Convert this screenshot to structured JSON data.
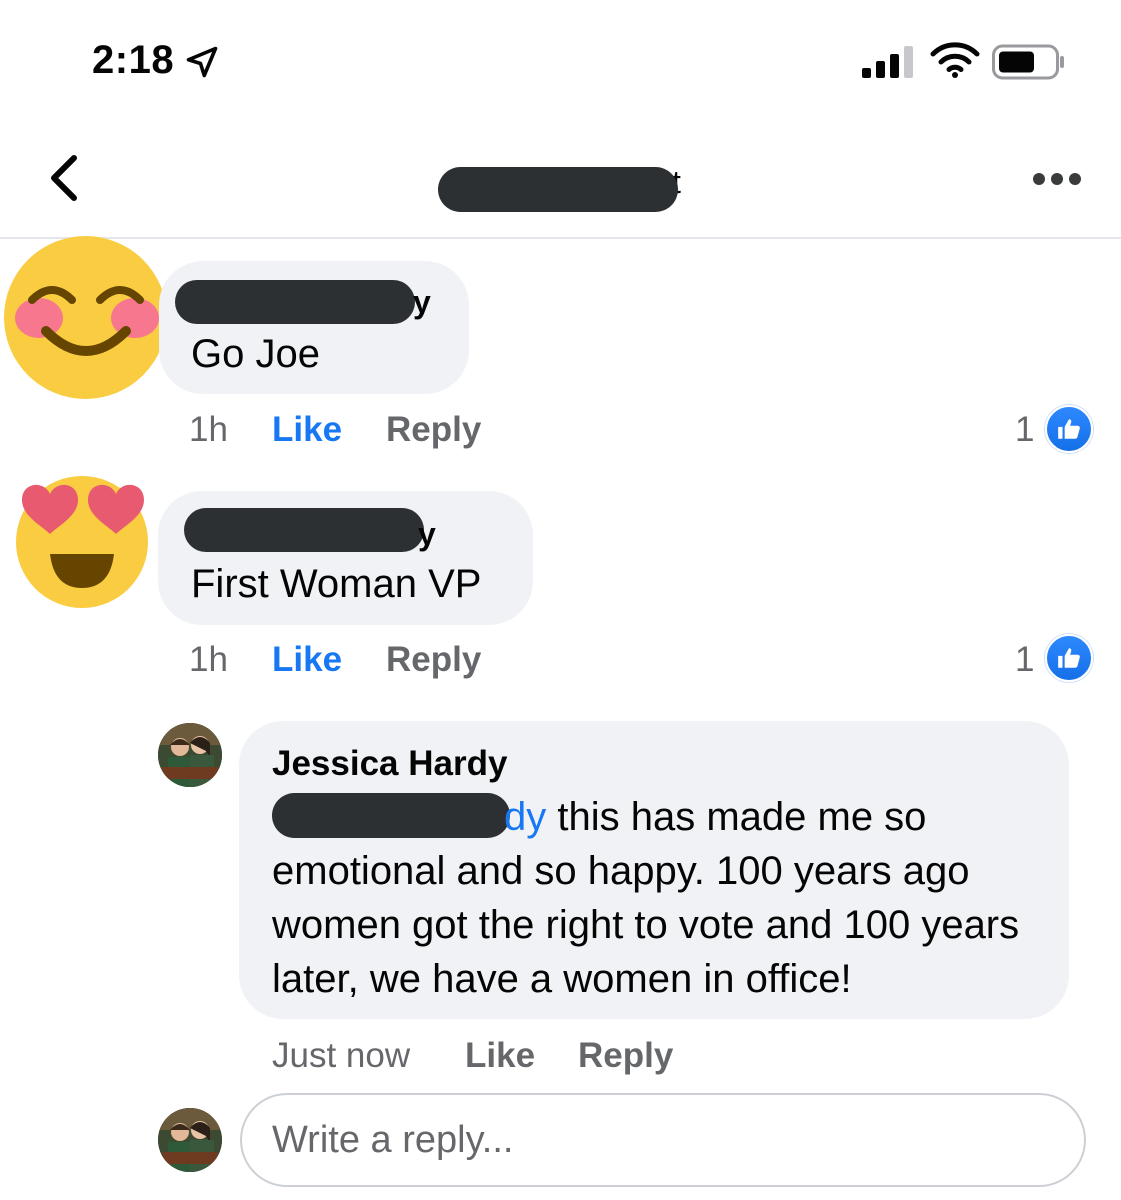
{
  "status_bar": {
    "time": "2:18",
    "icons": [
      "location-arrow-icon",
      "signal-bars-icon",
      "wifi-icon",
      "battery-icon"
    ]
  },
  "nav": {
    "back_icon": "chevron-left-icon",
    "title_tail": "t",
    "more_icon": "more-dots-icon"
  },
  "comments": [
    {
      "avatar": "smiling-face-emoji",
      "name_tail": "y",
      "text": "Go Joe",
      "time": "1h",
      "like_label": "Like",
      "reply_label": "Reply",
      "like_count": "1"
    },
    {
      "avatar": "heart-eyes-emoji",
      "name_tail": "y",
      "text": "First Woman VP",
      "time": "1h",
      "like_label": "Like",
      "reply_label": "Reply",
      "like_count": "1"
    }
  ],
  "reply": {
    "author": "Jessica Hardy",
    "mention_tail": "dy",
    "text": " this has made me so emotional and so happy. 100 years ago women got the right to vote and 100 years later, we have a women in office!",
    "time": "Just now",
    "like_label": "Like",
    "reply_label": "Reply"
  },
  "composer": {
    "placeholder": "Write a reply..."
  },
  "colors": {
    "accent": "#1877f2",
    "bubble": "#f0f2f5",
    "secondary_text": "#65676b",
    "redaction": "#2c3033"
  }
}
